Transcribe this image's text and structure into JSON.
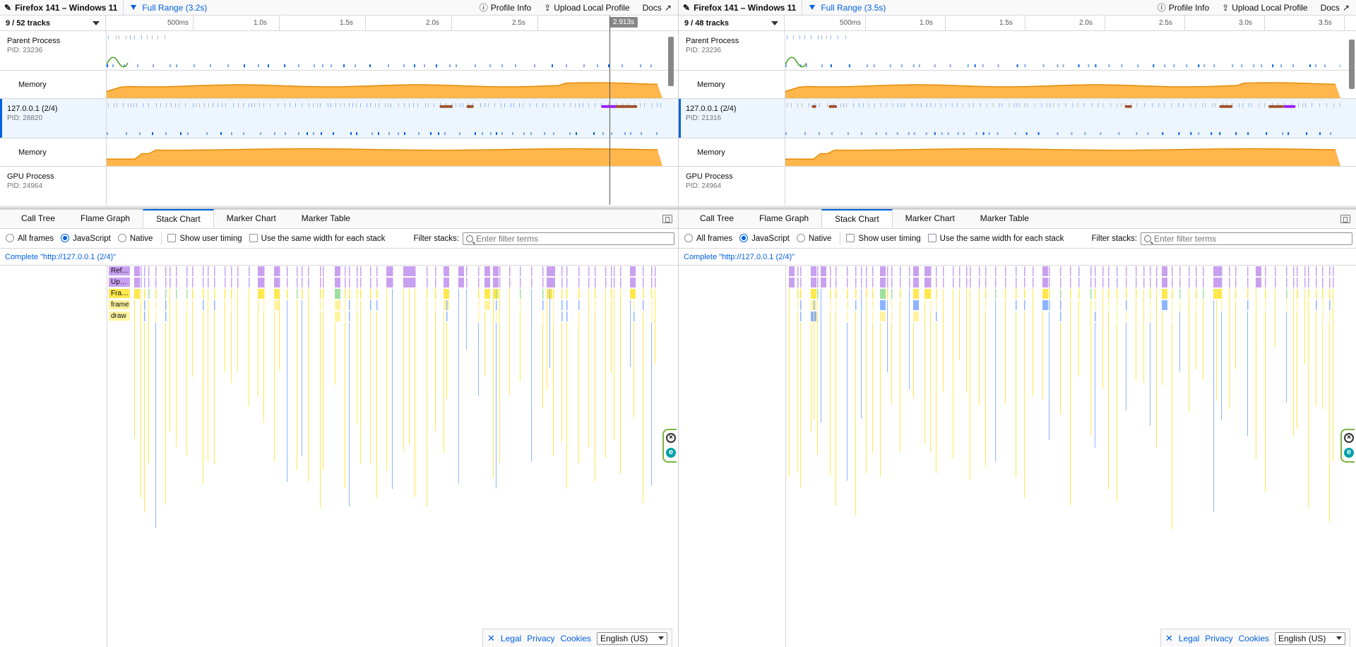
{
  "colors": {
    "accent": "#0060df",
    "memory": "#ffb64d",
    "memory_line": "#e68a00",
    "js": "#c9a0f0",
    "frame": "#ffe84d",
    "dom": "#8cb4ff"
  },
  "left": {
    "title": "Firefox 141 – Windows 11",
    "range": "Full Range (3.2s)",
    "track_count": "9 / 52 tracks",
    "ticks": [
      "500ms",
      "1.0s",
      "1.5s",
      "2.0s",
      "2.5s"
    ],
    "cursor_label": "2.913s",
    "tracks": [
      {
        "name": "Parent Process",
        "pid": "PID: 23236"
      },
      {
        "name": "Memory"
      },
      {
        "name": "127.0.0.1 (2/4)",
        "pid": "PID: 28820"
      },
      {
        "name": "Memory"
      },
      {
        "name": "GPU Process",
        "pid": "PID: 24964"
      }
    ],
    "breadcrumb": "Complete \"http://127.0.0.1 (2/4)\"",
    "stack_labels": [
      "Ref…",
      "Up…",
      "Fra…",
      "frame",
      "draw"
    ]
  },
  "right": {
    "title": "Firefox 141 – Windows 11",
    "range": "Full Range (3.5s)",
    "track_count": "9 / 48 tracks",
    "ticks": [
      "500ms",
      "1.0s",
      "1.5s",
      "2.0s",
      "2.5s",
      "3.0s",
      "3.5s"
    ],
    "tracks": [
      {
        "name": "Parent Process",
        "pid": "PID: 23236"
      },
      {
        "name": "Memory"
      },
      {
        "name": "127.0.0.1 (2/4)",
        "pid": "PID: 21316"
      },
      {
        "name": "Memory"
      },
      {
        "name": "GPU Process",
        "pid": "PID: 24964"
      }
    ],
    "breadcrumb": "Complete \"http://127.0.0.1 (2/4)\""
  },
  "toolbar": {
    "profile_info": "Profile Info",
    "upload": "Upload Local Profile",
    "docs": "Docs"
  },
  "tabs": [
    "Call Tree",
    "Flame Graph",
    "Stack Chart",
    "Marker Chart",
    "Marker Table"
  ],
  "settings": {
    "all_frames": "All frames",
    "javascript": "JavaScript",
    "native": "Native",
    "show_user_timing": "Show user timing",
    "same_width": "Use the same width for each stack",
    "filter_label": "Filter stacks:",
    "filter_placeholder": "Enter filter terms"
  },
  "footer": {
    "legal": "Legal",
    "privacy": "Privacy",
    "cookies": "Cookies",
    "language": "English (US)"
  }
}
